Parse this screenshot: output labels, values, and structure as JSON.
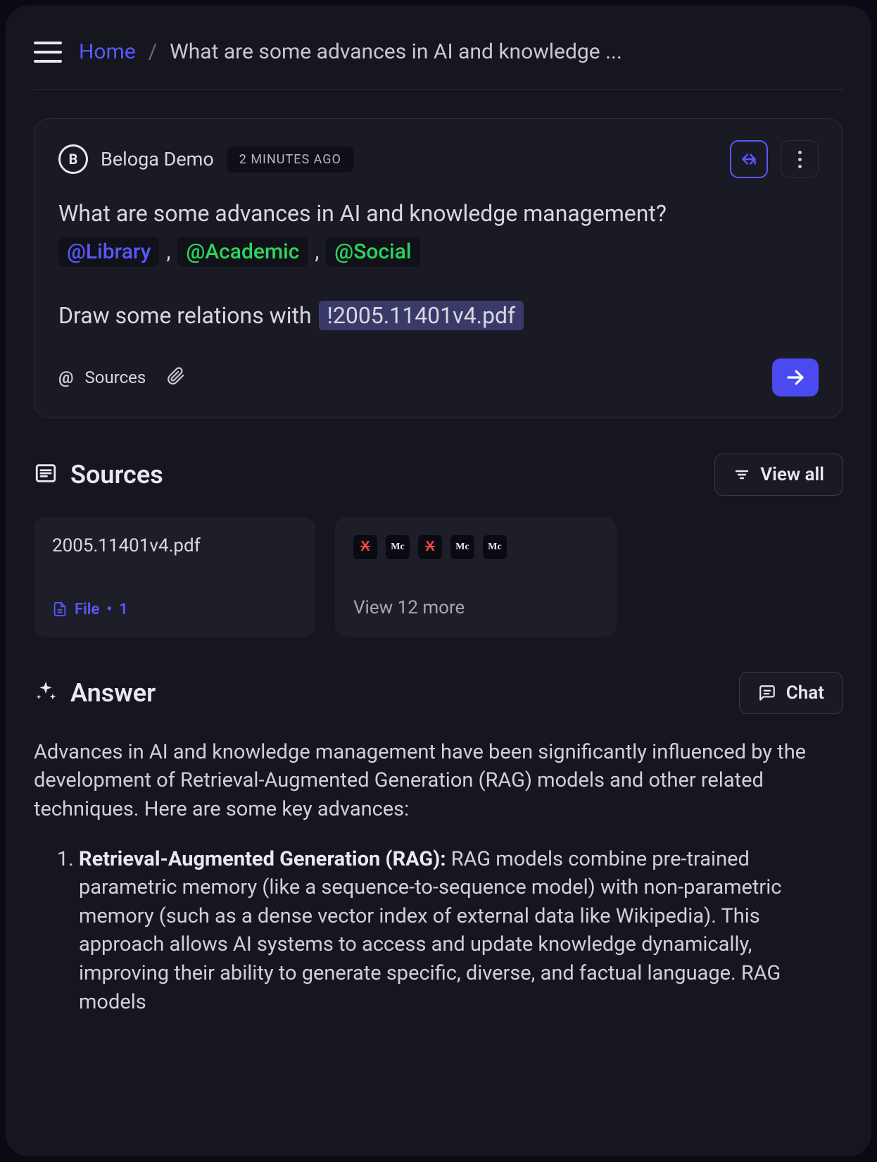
{
  "breadcrumb": {
    "home": "Home",
    "sep": "/",
    "current": "What are some advances in AI and knowledge ..."
  },
  "query_card": {
    "avatar_letter": "B",
    "username": "Beloga Demo",
    "timestamp": "2 MINUTES AGO",
    "question": "What are some advances in AI and knowledge management?",
    "tags": {
      "library": "@Library",
      "academic": "@Academic",
      "social": "@Social"
    },
    "relation_prefix": "Draw some relations with",
    "file_ref": "!2005.11401v4.pdf",
    "sources_label": "Sources"
  },
  "sources_section": {
    "heading": "Sources",
    "view_all": "View all",
    "card1": {
      "title": "2005.11401v4.pdf",
      "type": "File",
      "count": "1"
    },
    "card2": {
      "more_text": "View 12 more"
    }
  },
  "answer_section": {
    "heading": "Answer",
    "chat_label": "Chat",
    "intro": "Advances in AI and knowledge management have been significantly influenced by the development of Retrieval-Augmented Generation (RAG) models and other related techniques. Here are some key advances:",
    "item1_title": "Retrieval-Augmented Generation (RAG):",
    "item1_body": " RAG models combine pre-trained parametric memory (like a sequence-to-sequence model) with non-parametric memory (such as a dense vector index of external data like Wikipedia). This approach allows AI systems to access and update knowledge dynamically, improving their ability to generate specific, diverse, and factual language. RAG models"
  }
}
